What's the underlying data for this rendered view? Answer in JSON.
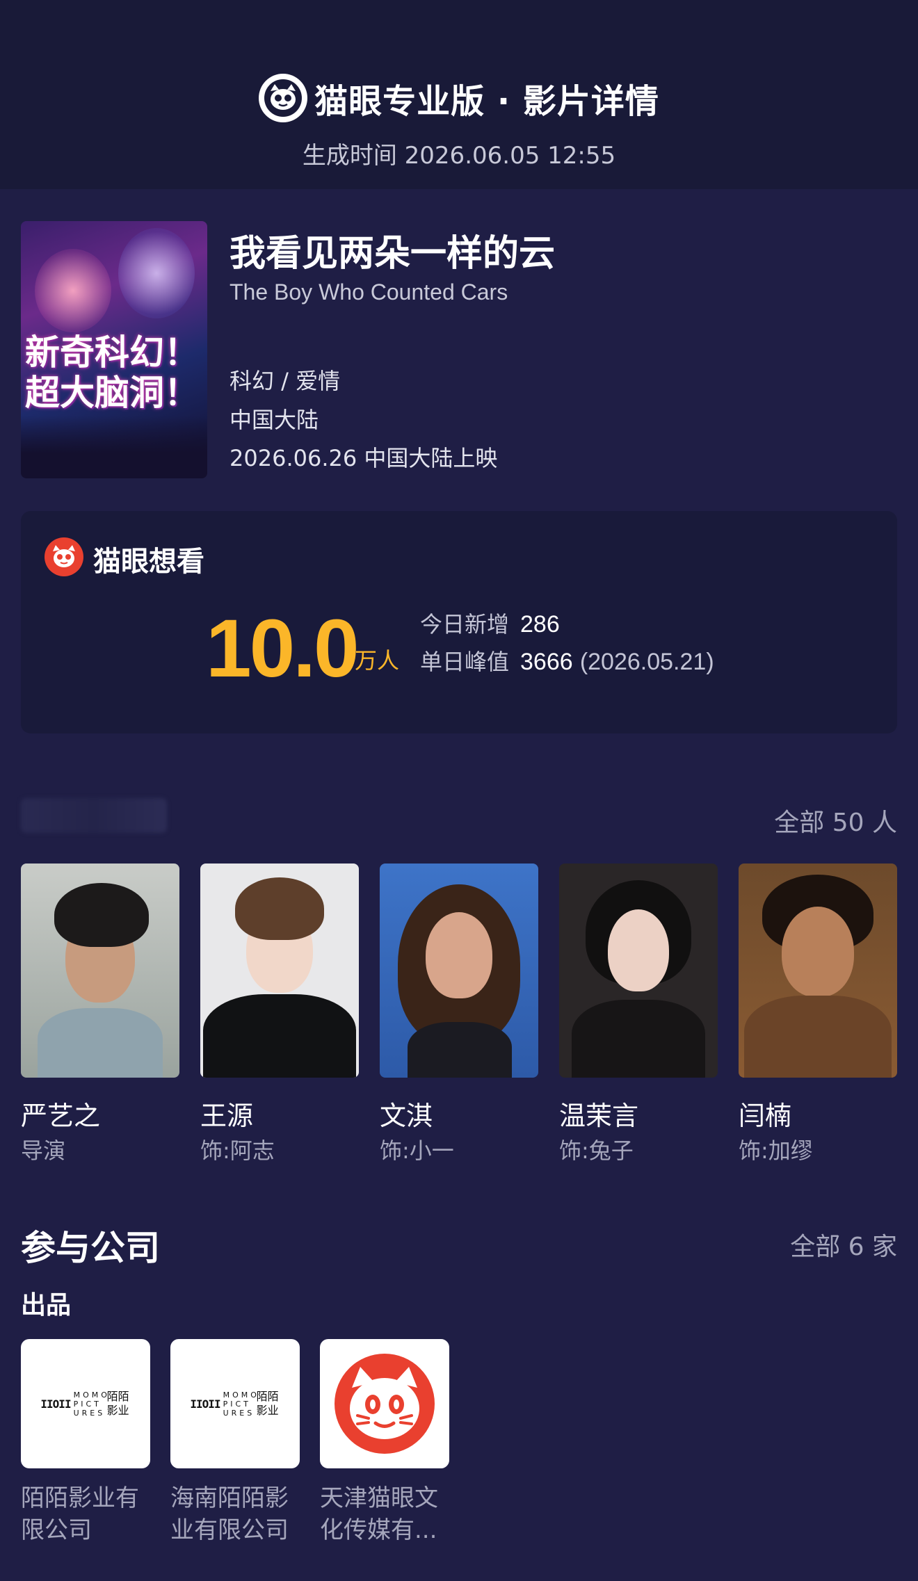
{
  "header": {
    "title": "猫眼专业版 · 影片详情",
    "generated": "生成时间 2026.06.05 12:55"
  },
  "movie": {
    "poster_slogan_1": "新奇科幻！",
    "poster_slogan_2": "超大脑洞！",
    "title": "我看见两朵一样的云",
    "title_en": "The Boy Who Counted Cars",
    "genre": "科幻 / 爱情",
    "region": "中国大陆",
    "release": "2026.06.26 中国大陆上映"
  },
  "want": {
    "title": "猫眼想看",
    "number": "10.0",
    "unit": "万人",
    "today_label": "今日新增",
    "today_value": "286",
    "peak_label": "单日峰值",
    "peak_value": "3666",
    "peak_date": "(2026.05.21)"
  },
  "cast": {
    "all_label": "全部 50 人",
    "members": [
      {
        "name": "严艺之",
        "role": "导演"
      },
      {
        "name": "王源",
        "role": "饰:阿志"
      },
      {
        "name": "文淇",
        "role": "饰:小一"
      },
      {
        "name": "温茉言",
        "role": "饰:兔子"
      },
      {
        "name": "闫楠",
        "role": "饰:加缪"
      }
    ]
  },
  "companies": {
    "title": "参与公司",
    "all_label": "全部 6 家",
    "category": "出品",
    "momo_mark": "IIOII",
    "momo_text": "MOMO PICT URES",
    "momo_cn": "陌陌 影业",
    "items": [
      {
        "name_line1": "陌陌影业有",
        "name_line2": "限公司"
      },
      {
        "name_line1": "海南陌陌影",
        "name_line2": "业有限公司"
      },
      {
        "name_line1": "天津猫眼文",
        "name_line2": "化传媒有..."
      }
    ]
  },
  "colors": {
    "background": "#1f1e45",
    "header": "#191a38",
    "accent_yellow": "#fbb629",
    "maoyan_red": "#e9402f"
  }
}
